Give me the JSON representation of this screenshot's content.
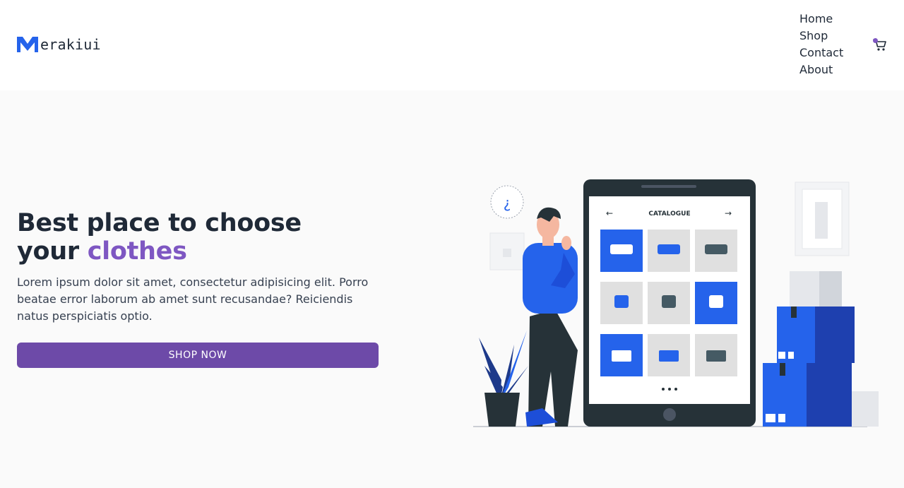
{
  "header": {
    "logo_text": "erakiui",
    "nav": [
      "Home",
      "Shop",
      "Contact",
      "About"
    ],
    "cart_icon": "cart-icon"
  },
  "hero": {
    "title_line1": "Best place to choose",
    "title_word": "your",
    "title_accent": "clothes",
    "description": "Lorem ipsum dolor sit amet, consectetur adipisicing elit. Porro beatae error laborum ab amet sunt recusandae? Reiciendis natus perspiciatis optio.",
    "cta_label": "SHOP NOW"
  },
  "illustration": {
    "catalogue_label": "CATALOGUE",
    "question_mark": "¿"
  },
  "colors": {
    "accent": "#7e57c2",
    "button": "#6d4aa8",
    "brand_blue": "#2563eb",
    "dark": "#263238"
  }
}
